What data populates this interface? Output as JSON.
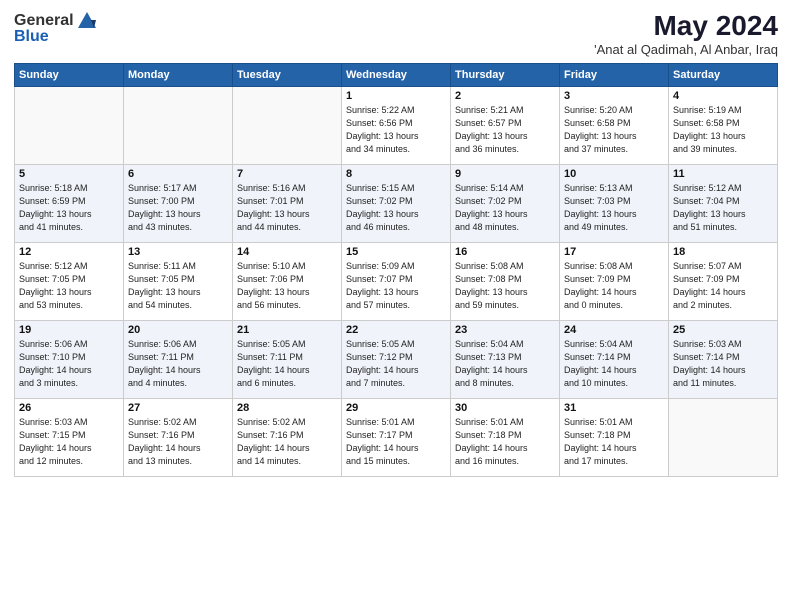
{
  "header": {
    "logo_general": "General",
    "logo_blue": "Blue",
    "title": "May 2024",
    "subtitle": "'Anat al Qadimah, Al Anbar, Iraq"
  },
  "weekdays": [
    "Sunday",
    "Monday",
    "Tuesday",
    "Wednesday",
    "Thursday",
    "Friday",
    "Saturday"
  ],
  "weeks": [
    {
      "shaded": false,
      "days": [
        {
          "num": "",
          "info": ""
        },
        {
          "num": "",
          "info": ""
        },
        {
          "num": "",
          "info": ""
        },
        {
          "num": "1",
          "info": "Sunrise: 5:22 AM\nSunset: 6:56 PM\nDaylight: 13 hours\nand 34 minutes."
        },
        {
          "num": "2",
          "info": "Sunrise: 5:21 AM\nSunset: 6:57 PM\nDaylight: 13 hours\nand 36 minutes."
        },
        {
          "num": "3",
          "info": "Sunrise: 5:20 AM\nSunset: 6:58 PM\nDaylight: 13 hours\nand 37 minutes."
        },
        {
          "num": "4",
          "info": "Sunrise: 5:19 AM\nSunset: 6:58 PM\nDaylight: 13 hours\nand 39 minutes."
        }
      ]
    },
    {
      "shaded": true,
      "days": [
        {
          "num": "5",
          "info": "Sunrise: 5:18 AM\nSunset: 6:59 PM\nDaylight: 13 hours\nand 41 minutes."
        },
        {
          "num": "6",
          "info": "Sunrise: 5:17 AM\nSunset: 7:00 PM\nDaylight: 13 hours\nand 43 minutes."
        },
        {
          "num": "7",
          "info": "Sunrise: 5:16 AM\nSunset: 7:01 PM\nDaylight: 13 hours\nand 44 minutes."
        },
        {
          "num": "8",
          "info": "Sunrise: 5:15 AM\nSunset: 7:02 PM\nDaylight: 13 hours\nand 46 minutes."
        },
        {
          "num": "9",
          "info": "Sunrise: 5:14 AM\nSunset: 7:02 PM\nDaylight: 13 hours\nand 48 minutes."
        },
        {
          "num": "10",
          "info": "Sunrise: 5:13 AM\nSunset: 7:03 PM\nDaylight: 13 hours\nand 49 minutes."
        },
        {
          "num": "11",
          "info": "Sunrise: 5:12 AM\nSunset: 7:04 PM\nDaylight: 13 hours\nand 51 minutes."
        }
      ]
    },
    {
      "shaded": false,
      "days": [
        {
          "num": "12",
          "info": "Sunrise: 5:12 AM\nSunset: 7:05 PM\nDaylight: 13 hours\nand 53 minutes."
        },
        {
          "num": "13",
          "info": "Sunrise: 5:11 AM\nSunset: 7:05 PM\nDaylight: 13 hours\nand 54 minutes."
        },
        {
          "num": "14",
          "info": "Sunrise: 5:10 AM\nSunset: 7:06 PM\nDaylight: 13 hours\nand 56 minutes."
        },
        {
          "num": "15",
          "info": "Sunrise: 5:09 AM\nSunset: 7:07 PM\nDaylight: 13 hours\nand 57 minutes."
        },
        {
          "num": "16",
          "info": "Sunrise: 5:08 AM\nSunset: 7:08 PM\nDaylight: 13 hours\nand 59 minutes."
        },
        {
          "num": "17",
          "info": "Sunrise: 5:08 AM\nSunset: 7:09 PM\nDaylight: 14 hours\nand 0 minutes."
        },
        {
          "num": "18",
          "info": "Sunrise: 5:07 AM\nSunset: 7:09 PM\nDaylight: 14 hours\nand 2 minutes."
        }
      ]
    },
    {
      "shaded": true,
      "days": [
        {
          "num": "19",
          "info": "Sunrise: 5:06 AM\nSunset: 7:10 PM\nDaylight: 14 hours\nand 3 minutes."
        },
        {
          "num": "20",
          "info": "Sunrise: 5:06 AM\nSunset: 7:11 PM\nDaylight: 14 hours\nand 4 minutes."
        },
        {
          "num": "21",
          "info": "Sunrise: 5:05 AM\nSunset: 7:11 PM\nDaylight: 14 hours\nand 6 minutes."
        },
        {
          "num": "22",
          "info": "Sunrise: 5:05 AM\nSunset: 7:12 PM\nDaylight: 14 hours\nand 7 minutes."
        },
        {
          "num": "23",
          "info": "Sunrise: 5:04 AM\nSunset: 7:13 PM\nDaylight: 14 hours\nand 8 minutes."
        },
        {
          "num": "24",
          "info": "Sunrise: 5:04 AM\nSunset: 7:14 PM\nDaylight: 14 hours\nand 10 minutes."
        },
        {
          "num": "25",
          "info": "Sunrise: 5:03 AM\nSunset: 7:14 PM\nDaylight: 14 hours\nand 11 minutes."
        }
      ]
    },
    {
      "shaded": false,
      "days": [
        {
          "num": "26",
          "info": "Sunrise: 5:03 AM\nSunset: 7:15 PM\nDaylight: 14 hours\nand 12 minutes."
        },
        {
          "num": "27",
          "info": "Sunrise: 5:02 AM\nSunset: 7:16 PM\nDaylight: 14 hours\nand 13 minutes."
        },
        {
          "num": "28",
          "info": "Sunrise: 5:02 AM\nSunset: 7:16 PM\nDaylight: 14 hours\nand 14 minutes."
        },
        {
          "num": "29",
          "info": "Sunrise: 5:01 AM\nSunset: 7:17 PM\nDaylight: 14 hours\nand 15 minutes."
        },
        {
          "num": "30",
          "info": "Sunrise: 5:01 AM\nSunset: 7:18 PM\nDaylight: 14 hours\nand 16 minutes."
        },
        {
          "num": "31",
          "info": "Sunrise: 5:01 AM\nSunset: 7:18 PM\nDaylight: 14 hours\nand 17 minutes."
        },
        {
          "num": "",
          "info": ""
        }
      ]
    }
  ]
}
